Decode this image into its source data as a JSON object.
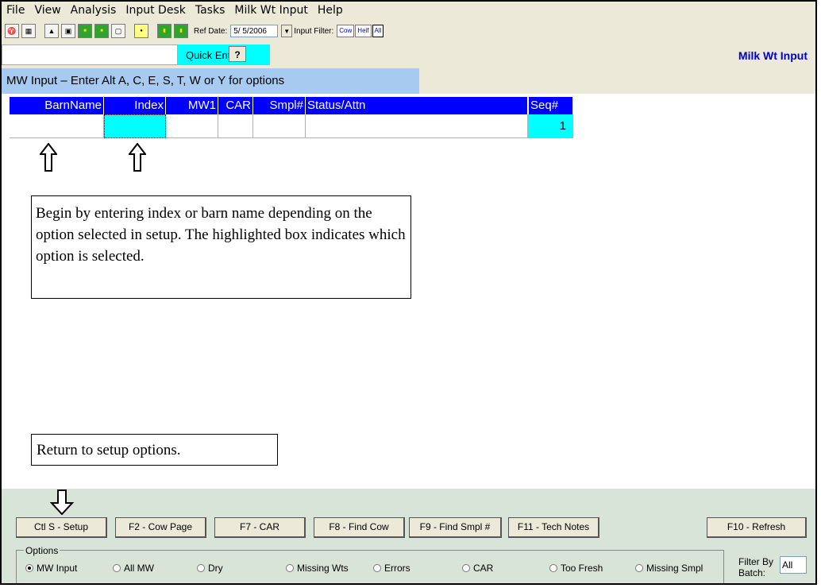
{
  "menu": [
    "File",
    "View",
    "Analysis",
    "Input Desk",
    "Tasks",
    "Milk Wt Input",
    "Help"
  ],
  "toolbar": {
    "ref_date_label": "Ref Date:",
    "ref_date_value": "5/ 5/2006",
    "input_filter_label": "Input Filter:",
    "filters": [
      "Cow",
      "Heif",
      "All"
    ]
  },
  "quick_entry": {
    "label": "Quick Entry",
    "help": "?"
  },
  "app_title": "Milk Wt Input",
  "instruction": "MW Input – Enter Alt A, C, E, S, T, W or Y for options",
  "grid": {
    "headers": [
      "BarnName",
      "Index",
      "MW1",
      "CAR",
      "Smpl#",
      "Status/Attn",
      "",
      "Seq#"
    ],
    "seq_value": "1"
  },
  "callouts": {
    "begin": "Begin by entering index or barn name depending on the option selected in setup. The highlighted box indicates which option is selected.",
    "return": "Return to setup options."
  },
  "buttons": [
    "Ctl S - Setup",
    "F2 - Cow Page",
    "F7 - CAR",
    "F8 - Find Cow",
    "F9 - Find Smpl #",
    "F11 - Tech Notes",
    "F10 - Refresh"
  ],
  "options": {
    "label": "Options",
    "items": [
      "MW Input",
      "All MW",
      "Dry",
      "Missing Wts",
      "Errors",
      "CAR",
      "Too Fresh",
      "Missing Smpl"
    ],
    "selected": "MW Input"
  },
  "filter_batch": {
    "label_line1": "Filter By",
    "label_line2": "Batch:",
    "value": "All"
  }
}
